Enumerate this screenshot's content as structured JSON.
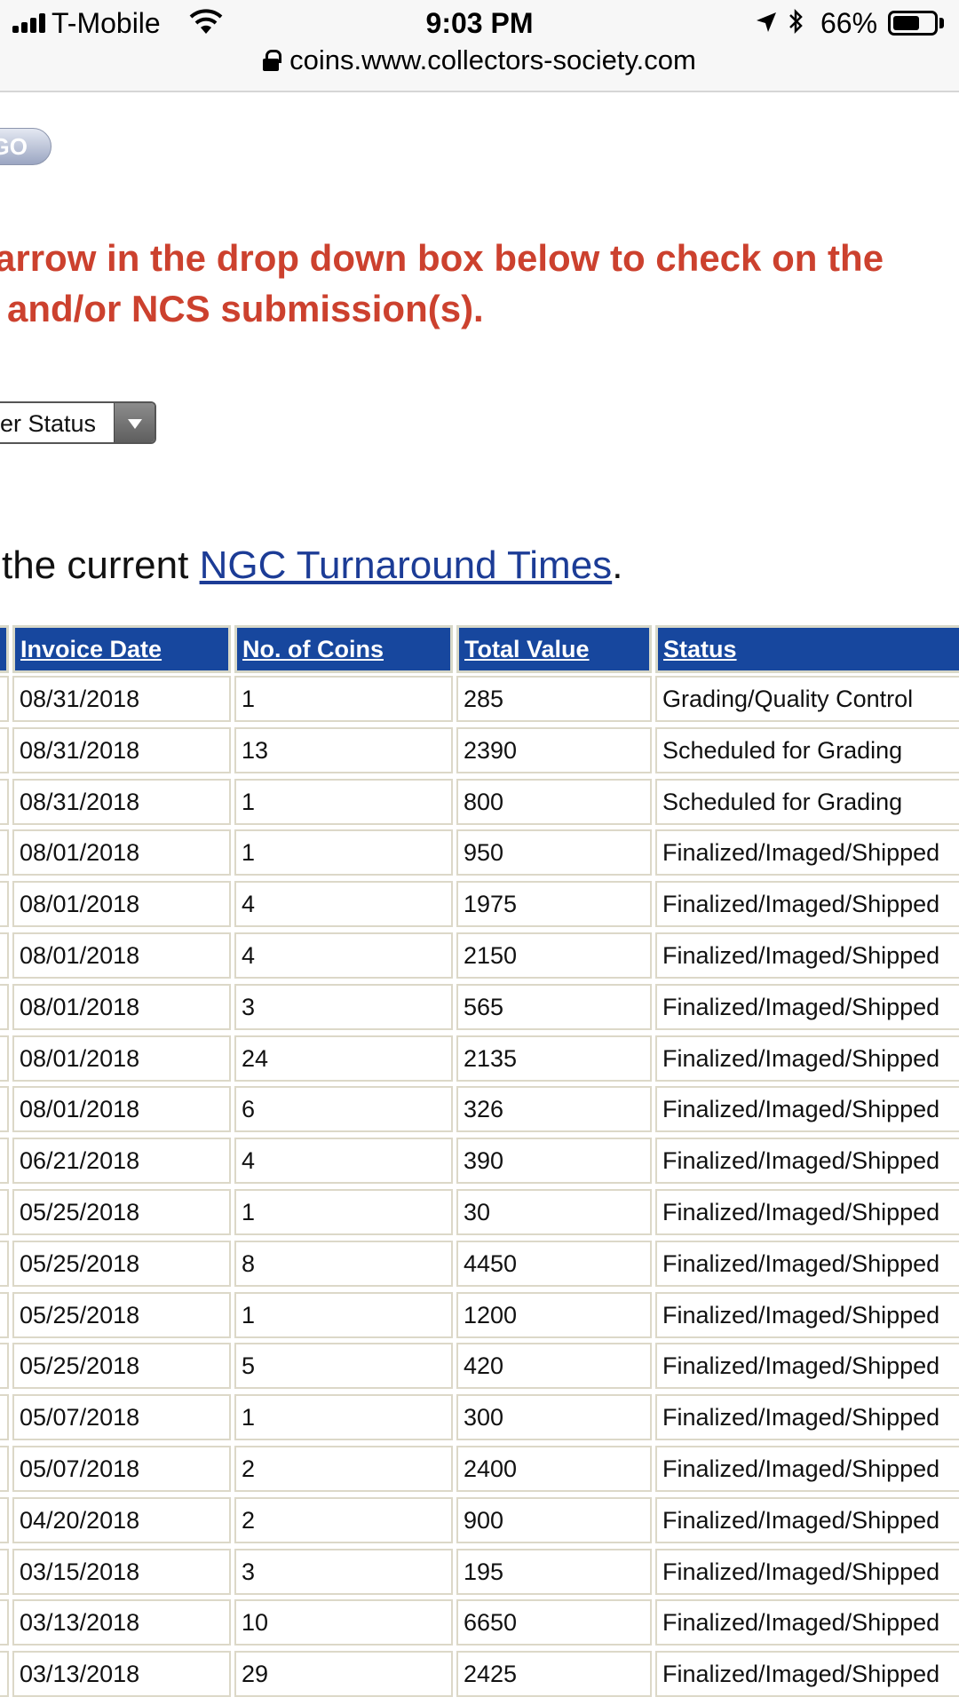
{
  "status_bar": {
    "carrier": "T-Mobile",
    "time": "9:03 PM",
    "battery": "66%",
    "battery_level": 0.66,
    "url": "coins.www.collectors-society.com"
  },
  "page": {
    "go_label": "GO",
    "instruction_line1": "arrow in the drop down box below to check on the",
    "instruction_line2": "and/or NCS submission(s).",
    "dropdown_value": "er Status",
    "turnaround_prefix": "the current ",
    "turnaround_link": "NGC Turnaround Times",
    "turnaround_suffix": "."
  },
  "table": {
    "headers": [
      "Invoice Date",
      "No. of Coins",
      "Total Value",
      "Status"
    ],
    "rows": [
      [
        "08/31/2018",
        "1",
        "285",
        "Grading/Quality Control"
      ],
      [
        "08/31/2018",
        "13",
        "2390",
        "Scheduled for Grading"
      ],
      [
        "08/31/2018",
        "1",
        "800",
        "Scheduled for Grading"
      ],
      [
        "08/01/2018",
        "1",
        "950",
        "Finalized/Imaged/Shipped"
      ],
      [
        "08/01/2018",
        "4",
        "1975",
        "Finalized/Imaged/Shipped"
      ],
      [
        "08/01/2018",
        "4",
        "2150",
        "Finalized/Imaged/Shipped"
      ],
      [
        "08/01/2018",
        "3",
        "565",
        "Finalized/Imaged/Shipped"
      ],
      [
        "08/01/2018",
        "24",
        "2135",
        "Finalized/Imaged/Shipped"
      ],
      [
        "08/01/2018",
        "6",
        "326",
        "Finalized/Imaged/Shipped"
      ],
      [
        "06/21/2018",
        "4",
        "390",
        "Finalized/Imaged/Shipped"
      ],
      [
        "05/25/2018",
        "1",
        "30",
        "Finalized/Imaged/Shipped"
      ],
      [
        "05/25/2018",
        "8",
        "4450",
        "Finalized/Imaged/Shipped"
      ],
      [
        "05/25/2018",
        "1",
        "1200",
        "Finalized/Imaged/Shipped"
      ],
      [
        "05/25/2018",
        "5",
        "420",
        "Finalized/Imaged/Shipped"
      ],
      [
        "05/07/2018",
        "1",
        "300",
        "Finalized/Imaged/Shipped"
      ],
      [
        "05/07/2018",
        "2",
        "2400",
        "Finalized/Imaged/Shipped"
      ],
      [
        "04/20/2018",
        "2",
        "900",
        "Finalized/Imaged/Shipped"
      ],
      [
        "03/15/2018",
        "3",
        "195",
        "Finalized/Imaged/Shipped"
      ],
      [
        "03/13/2018",
        "10",
        "6650",
        "Finalized/Imaged/Shipped"
      ],
      [
        "03/13/2018",
        "29",
        "2425",
        "Finalized/Imaged/Shipped"
      ]
    ]
  }
}
